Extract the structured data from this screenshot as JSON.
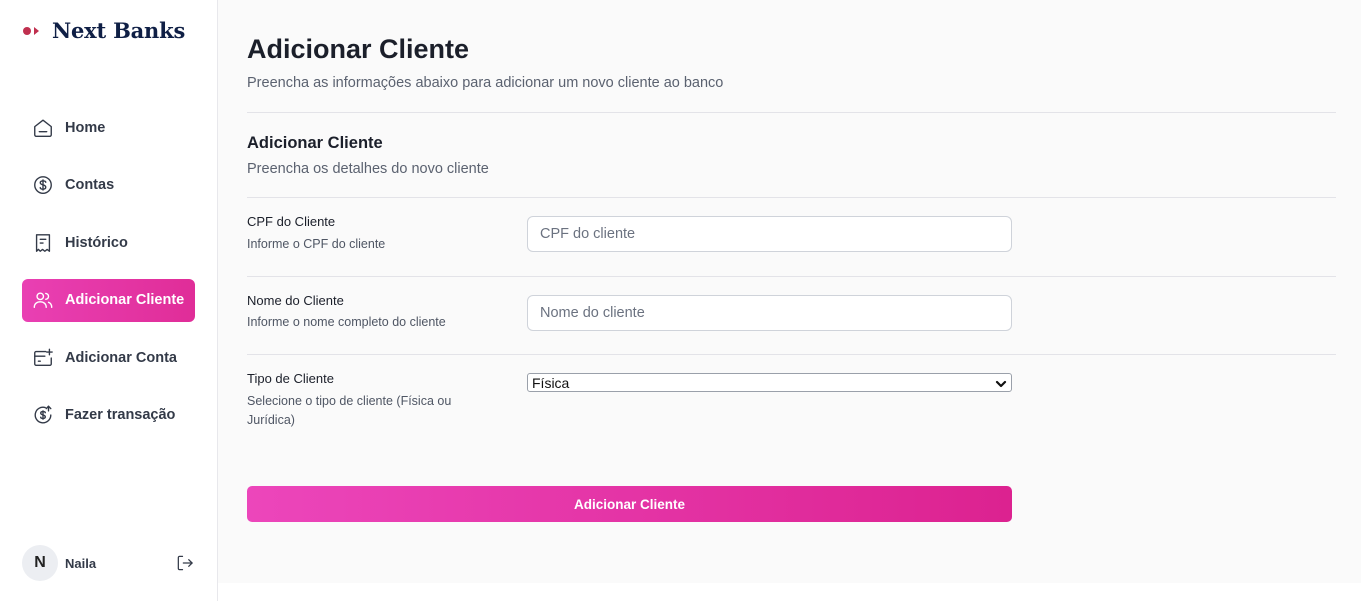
{
  "brand": {
    "name": "Next Banks",
    "colors": {
      "accent": "#e02d98",
      "navy": "#0f1f45",
      "logo_dot": "#c0304f"
    }
  },
  "sidebar": {
    "items": [
      {
        "label": "Home",
        "icon": "home-icon",
        "active": false
      },
      {
        "label": "Contas",
        "icon": "dollar-circle-icon",
        "active": false
      },
      {
        "label": "Histórico",
        "icon": "receipt-icon",
        "active": false
      },
      {
        "label": "Adicionar Cliente",
        "icon": "users-icon",
        "active": true
      },
      {
        "label": "Adicionar Conta",
        "icon": "card-plus-icon",
        "active": false
      },
      {
        "label": "Fazer transação",
        "icon": "dollar-transfer-icon",
        "active": false
      }
    ],
    "user": {
      "initial": "N",
      "name": "Naila",
      "logout_icon": "logout-icon"
    }
  },
  "main": {
    "title": "Adicionar Cliente",
    "subtitle": "Preencha as informações abaixo para adicionar um novo cliente ao banco",
    "section": {
      "title": "Adicionar Cliente",
      "subtitle": "Preencha os detalhes do novo cliente"
    },
    "fields": {
      "cpf": {
        "label": "CPF do Cliente",
        "help": "Informe o CPF do cliente",
        "placeholder": "CPF do cliente",
        "value": ""
      },
      "nome": {
        "label": "Nome do Cliente",
        "help": "Informe o nome completo do cliente",
        "placeholder": "Nome do cliente",
        "value": ""
      },
      "tipo": {
        "label": "Tipo de Cliente",
        "help": "Selecione o tipo de cliente (Física ou Jurídica)",
        "selected": "Física"
      }
    },
    "submit_label": "Adicionar Cliente"
  }
}
